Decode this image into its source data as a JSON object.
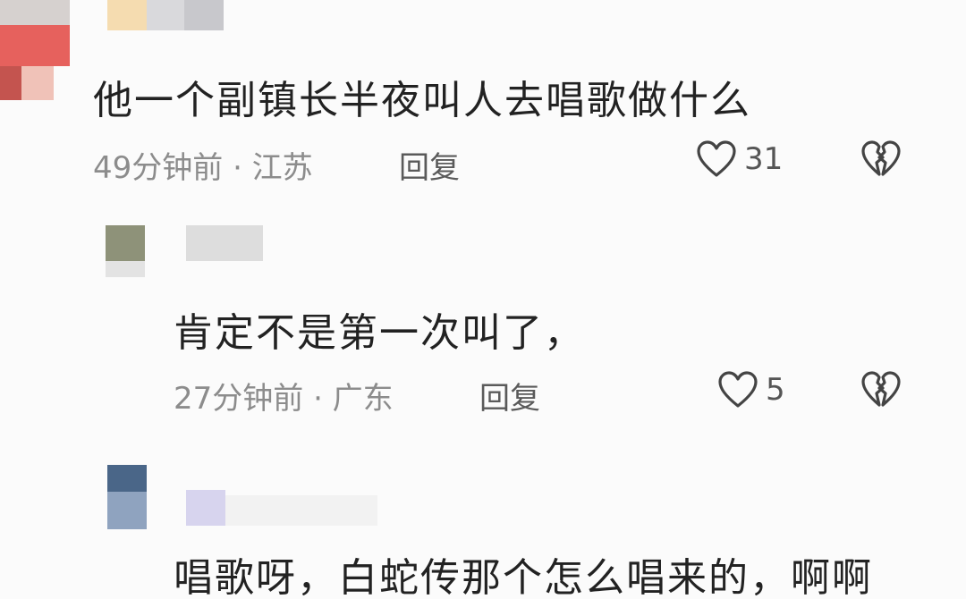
{
  "comments": [
    {
      "text": "他一个副镇长半夜叫人去唱歌做什么",
      "time_location": "49分钟前 · 江苏",
      "reply_label": "回复",
      "likes": "31"
    },
    {
      "text": "肯定不是第一次叫了，",
      "time_location": "27分钟前 · 广东",
      "reply_label": "回复",
      "likes": "5"
    },
    {
      "text": "唱歌呀，白蛇传那个怎么唱来的，啊啊"
    }
  ],
  "colors": {
    "text": "#222222",
    "meta": "#8c8c8c",
    "icon": "#444444"
  },
  "icons": {
    "like": "heart-outline-icon",
    "dislike": "broken-heart-icon"
  }
}
